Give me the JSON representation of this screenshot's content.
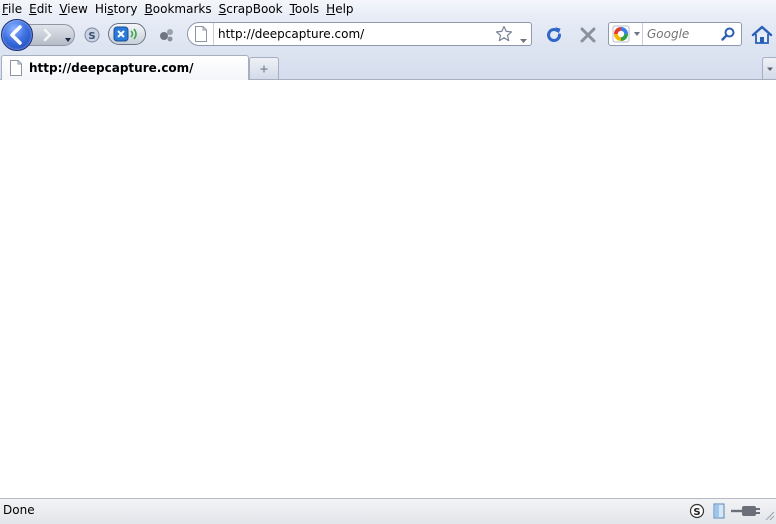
{
  "menubar": {
    "items": [
      {
        "mnemonic": "F",
        "rest": "ile"
      },
      {
        "mnemonic": "E",
        "rest": "dit"
      },
      {
        "mnemonic": "V",
        "rest": "iew"
      },
      {
        "pre": "Hi",
        "mnemonic": "s",
        "rest": "tory"
      },
      {
        "mnemonic": "B",
        "rest": "ookmarks"
      },
      {
        "mnemonic": "S",
        "rest": "crapBook"
      },
      {
        "mnemonic": "T",
        "rest": "ools"
      },
      {
        "mnemonic": "H",
        "rest": "elp"
      }
    ]
  },
  "toolbar": {
    "url": "http://deepcapture.com/",
    "search_engine": "google-icon",
    "search_placeholder": "Google"
  },
  "tabs": [
    {
      "title": "http://deepcapture.com/",
      "active": true
    }
  ],
  "statusbar": {
    "text": "Done"
  },
  "icons": {
    "back": "back-arrow-icon",
    "forward": "forward-arrow-icon",
    "reload": "reload-icon",
    "stop": "stop-icon",
    "home": "home-icon",
    "star": "bookmark-star-icon",
    "skype": "skype-icon"
  },
  "colors": {
    "back_button": "#3b6fe0",
    "reload": "#2f66c9",
    "stop": "#8a929e",
    "chrome": "#dde4f1"
  }
}
